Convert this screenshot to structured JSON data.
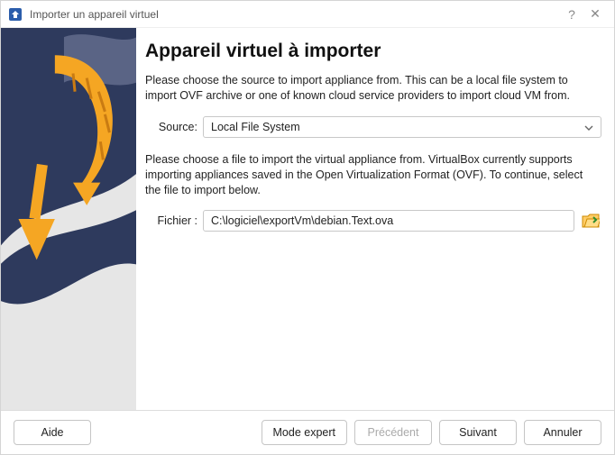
{
  "titlebar": {
    "title": "Importer un appareil virtuel",
    "help_glyph": "?",
    "close_glyph": "✕"
  },
  "content": {
    "heading": "Appareil virtuel à importer",
    "source_intro": "Please choose the source to import appliance from. This can be a local file system to import OVF archive or one of known cloud service providers to import cloud VM from.",
    "source_label": "Source:",
    "source_value": "Local File System",
    "file_intro": "Please choose a file to import the virtual appliance from. VirtualBox currently supports importing appliances saved in the Open Virtualization Format (OVF). To continue, select the file to import below.",
    "file_label": "Fichier :",
    "file_value": "C:\\logiciel\\exportVm\\debian.Text.ova"
  },
  "footer": {
    "help": "Aide",
    "expert": "Mode expert",
    "back": "Précédent",
    "next": "Suivant",
    "cancel": "Annuler"
  }
}
